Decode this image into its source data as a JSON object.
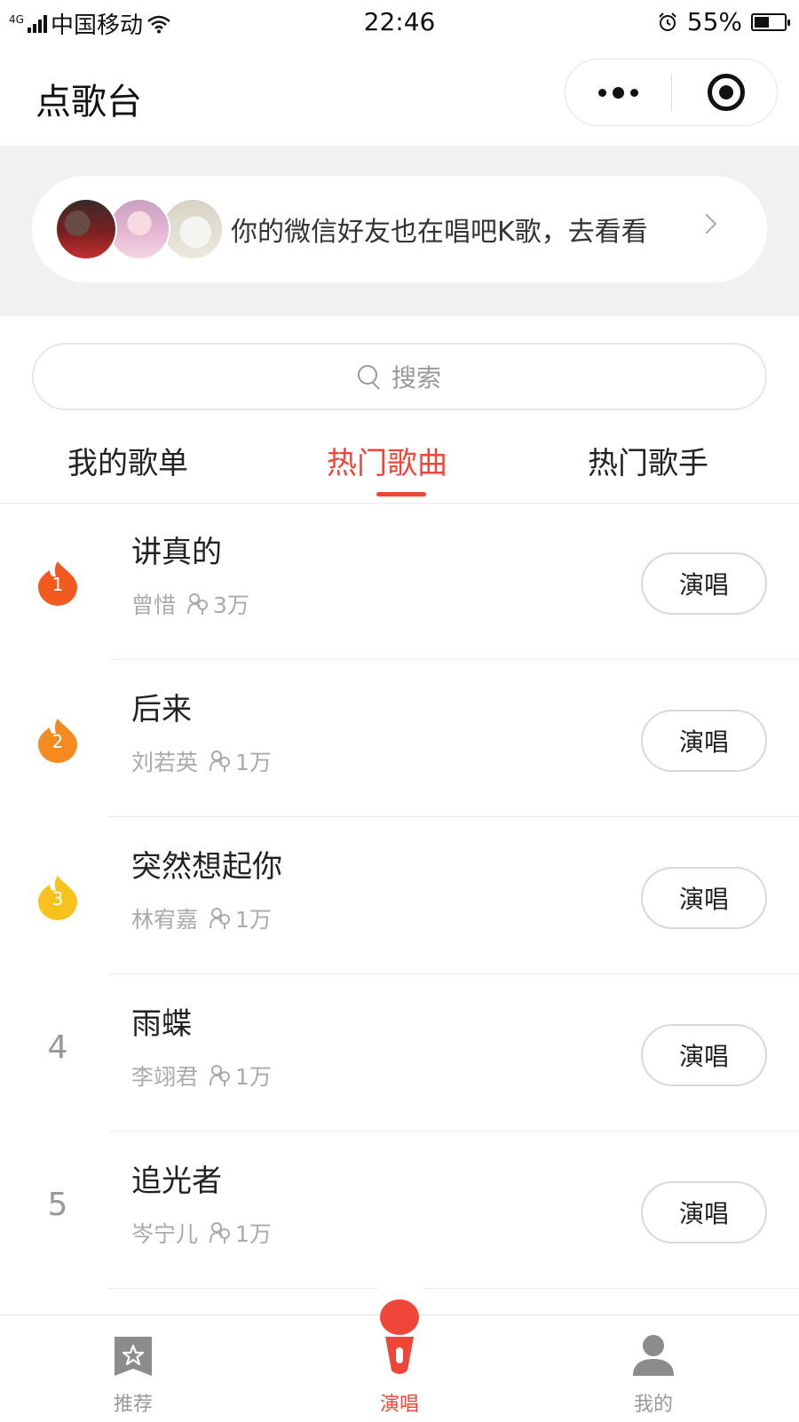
{
  "status_bar": {
    "network": "4G",
    "carrier": "中国移动",
    "time": "22:46",
    "battery": "55%",
    "battery_level": 0.55
  },
  "nav": {
    "title": "点歌台"
  },
  "friends_banner": {
    "text": "你的微信好友也在唱吧K歌，去看看"
  },
  "search": {
    "placeholder": "搜索"
  },
  "tabs": [
    {
      "label": "我的歌单",
      "active": false
    },
    {
      "label": "热门歌曲",
      "active": true
    },
    {
      "label": "热门歌手",
      "active": false
    }
  ],
  "songs": [
    {
      "rank": "1",
      "title": "讲真的",
      "artist": "曾惜",
      "singers": "3万",
      "action": "演唱",
      "badge_color": "#f2591e"
    },
    {
      "rank": "2",
      "title": "后来",
      "artist": "刘若英",
      "singers": "1万",
      "action": "演唱",
      "badge_color": "#f58b1f"
    },
    {
      "rank": "3",
      "title": "突然想起你",
      "artist": "林宥嘉",
      "singers": "1万",
      "action": "演唱",
      "badge_color": "#f7c21b"
    },
    {
      "rank": "4",
      "title": "雨蝶",
      "artist": "李翊君",
      "singers": "1万",
      "action": "演唱"
    },
    {
      "rank": "5",
      "title": "追光者",
      "artist": "岑宁儿",
      "singers": "1万",
      "action": "演唱"
    }
  ],
  "bottom_tabs": [
    {
      "label": "推荐",
      "icon": "star-bookmark-icon",
      "active": false
    },
    {
      "label": "演唱",
      "icon": "microphone-icon",
      "active": true
    },
    {
      "label": "我的",
      "icon": "person-icon",
      "active": false
    }
  ],
  "colors": {
    "accent": "#f0463a",
    "banner_bg": "#f2f0f3",
    "muted_text": "#aaaaaa"
  }
}
